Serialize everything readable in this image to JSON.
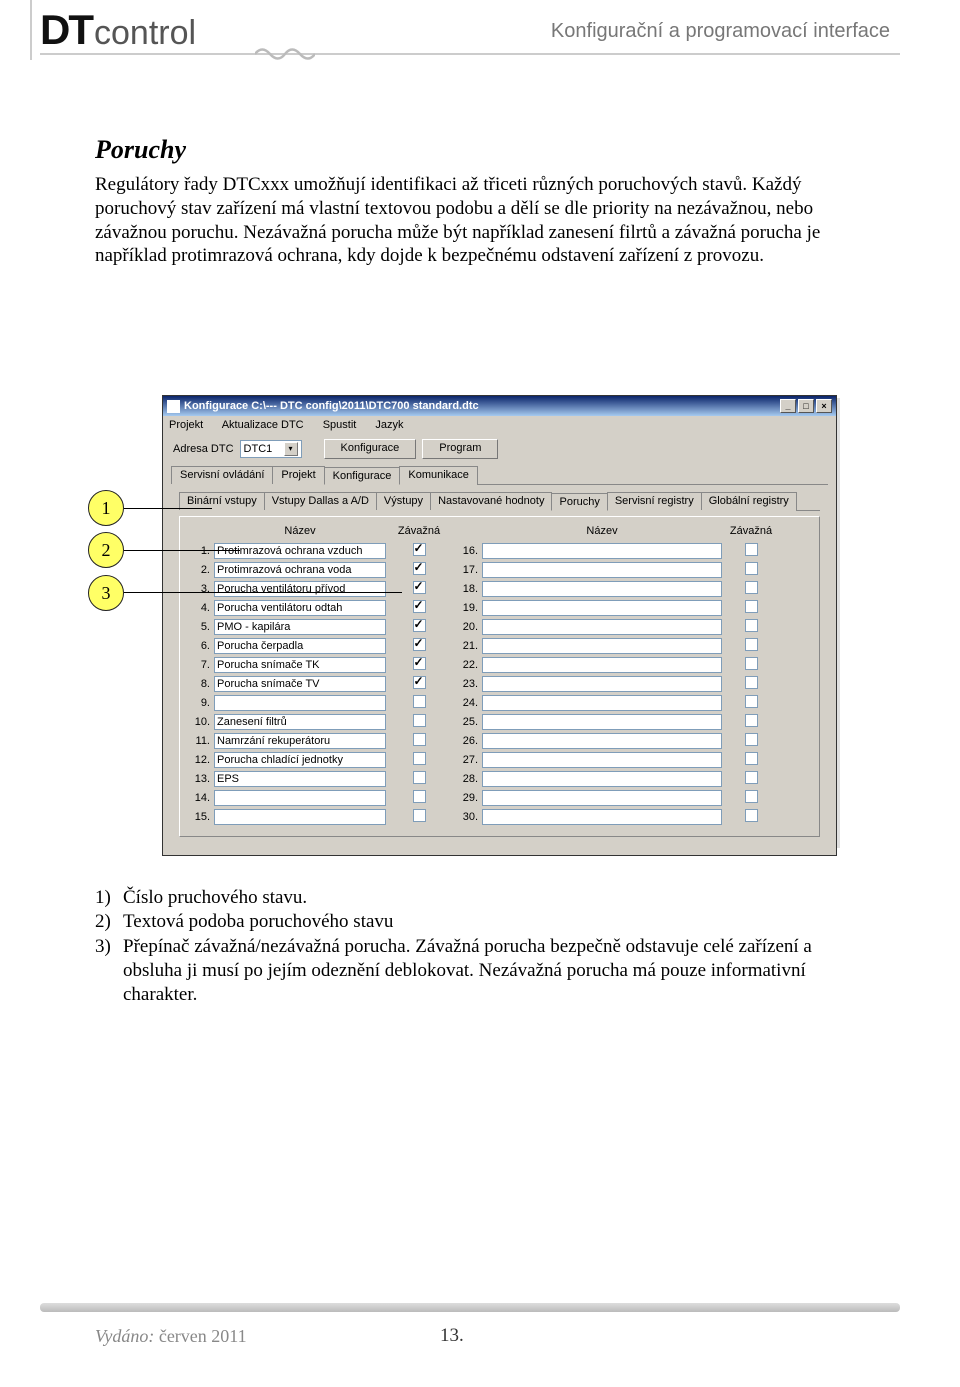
{
  "header": {
    "logo_dt": "DT",
    "logo_ctrl": "control",
    "right_text": "Konfigurační a programovací interface"
  },
  "content": {
    "title": "Poruchy",
    "paragraph": "Regulátory řady DTCxxx umožňují identifikaci až třiceti různých poruchových stavů. Každý poruchový stav zařízení má vlastní textovou podobu a dělí se dle priority na nezávažnou, nebo závažnou poruchu. Nezávažná porucha může být například zanesení filrtů a závažná porucha je například protimrazová ochrana, kdy dojde k bezpečnému odstavení zařízení z provozu."
  },
  "callouts": {
    "c1": "1",
    "c2": "2",
    "c3": "3"
  },
  "screenshot": {
    "title": "Konfigurace C:\\--- DTC config\\2011\\DTC700 standard.dtc",
    "winbuttons": {
      "min": "_",
      "max": "□",
      "close": "×"
    },
    "menus": [
      "Projekt",
      "Aktualizace DTC",
      "Spustit",
      "Jazyk"
    ],
    "address_label": "Adresa DTC",
    "address_value": "DTC1",
    "btn_konfig": "Konfigurace",
    "btn_program": "Program",
    "tabs_main": [
      "Servisní ovládání",
      "Projekt",
      "Konfigurace",
      "Komunikace"
    ],
    "tab_main_active": 2,
    "tabs_sub": [
      "Binární vstupy",
      "Vstupy Dallas a A/D",
      "Výstupy",
      "Nastavované hodnoty",
      "Poruchy",
      "Servisní registry",
      "Globální registry"
    ],
    "tab_sub_active": 4,
    "col_headers": {
      "name": "Název",
      "sev": "Závažná",
      "name2": "Název",
      "sev2": "Závažná"
    },
    "rows_left": [
      {
        "n": "1.",
        "name": "Protimrazová ochrana vzduch",
        "chk": true
      },
      {
        "n": "2.",
        "name": "Protimrazová ochrana voda",
        "chk": true
      },
      {
        "n": "3.",
        "name": "Porucha ventilátoru přívod",
        "chk": true
      },
      {
        "n": "4.",
        "name": "Porucha ventilátoru odtah",
        "chk": true
      },
      {
        "n": "5.",
        "name": "PMO - kapilára",
        "chk": true
      },
      {
        "n": "6.",
        "name": "Porucha čerpadla",
        "chk": true
      },
      {
        "n": "7.",
        "name": "Porucha snímače TK",
        "chk": true
      },
      {
        "n": "8.",
        "name": "Porucha snímače TV",
        "chk": true
      },
      {
        "n": "9.",
        "name": "",
        "chk": false
      },
      {
        "n": "10.",
        "name": "Zanesení filtrů",
        "chk": false
      },
      {
        "n": "11.",
        "name": "Namrzání rekuperátoru",
        "chk": false
      },
      {
        "n": "12.",
        "name": "Porucha chladící jednotky",
        "chk": false
      },
      {
        "n": "13.",
        "name": "EPS",
        "chk": false
      },
      {
        "n": "14.",
        "name": "",
        "chk": false
      },
      {
        "n": "15.",
        "name": "",
        "chk": false
      }
    ],
    "rows_right": [
      {
        "n": "16.",
        "chk": false
      },
      {
        "n": "17.",
        "chk": false
      },
      {
        "n": "18.",
        "chk": false
      },
      {
        "n": "19.",
        "chk": false
      },
      {
        "n": "20.",
        "chk": false
      },
      {
        "n": "21.",
        "chk": false
      },
      {
        "n": "22.",
        "chk": false
      },
      {
        "n": "23.",
        "chk": false
      },
      {
        "n": "24.",
        "chk": false
      },
      {
        "n": "25.",
        "chk": false
      },
      {
        "n": "26.",
        "chk": false
      },
      {
        "n": "27.",
        "chk": false
      },
      {
        "n": "28.",
        "chk": false
      },
      {
        "n": "29.",
        "chk": false
      },
      {
        "n": "30.",
        "chk": false
      }
    ]
  },
  "lower": {
    "items": [
      {
        "n": "1)",
        "text": "Číslo pruchového stavu."
      },
      {
        "n": "2)",
        "text": "Textová podoba poruchového stavu"
      },
      {
        "n": "3)",
        "text": "Přepínač závažná/nezávažná porucha. Závažná porucha bezpečně odstavuje celé zařízení a obsluha ji musí po jejím odeznění deblokovat. Nezávažná porucha má pouze informativní charakter."
      }
    ]
  },
  "footer": {
    "issued_label": "Vydáno:",
    "issued_value": "červen 2011",
    "page": "13."
  }
}
